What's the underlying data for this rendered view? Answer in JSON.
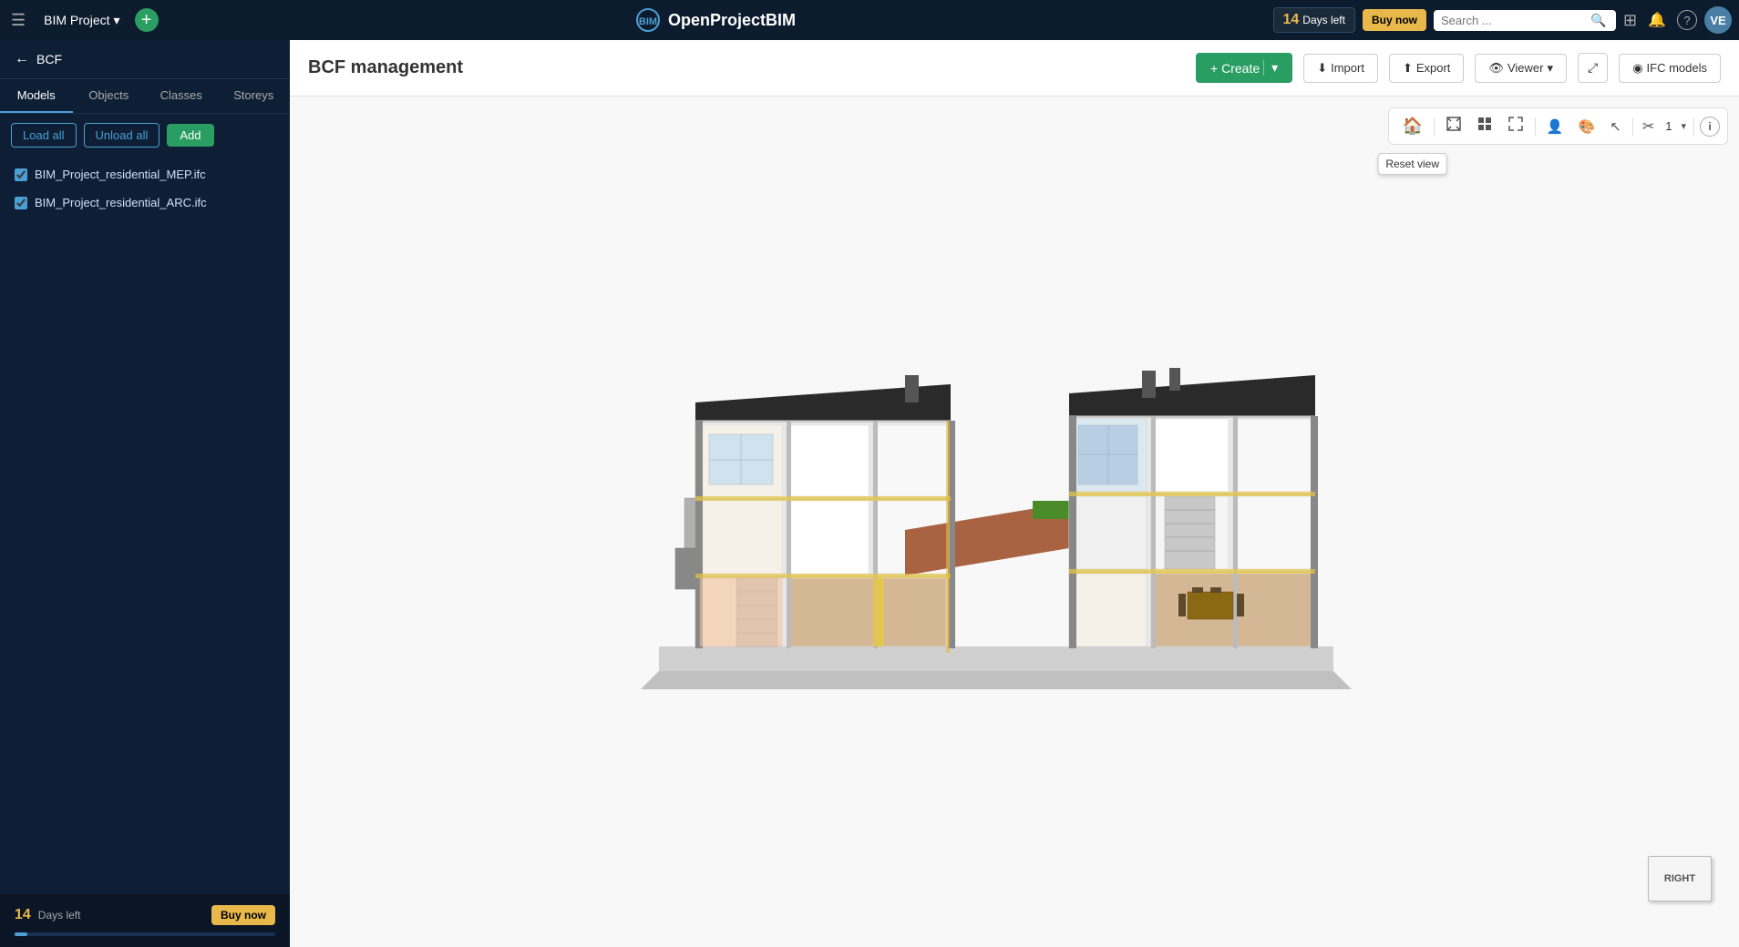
{
  "topnav": {
    "menu_icon": "☰",
    "project_name": "BIM Project",
    "project_caret": "▾",
    "add_icon": "+",
    "logo_text": "OpenProjectBIM",
    "trial_days": "14",
    "trial_days_label": "Days left",
    "buy_now_label": "Buy now",
    "search_placeholder": "Search ...",
    "grid_icon": "⊞",
    "bell_icon": "🔔",
    "help_icon": "?",
    "avatar_initials": "VE"
  },
  "sidebar": {
    "back_label": "BCF",
    "tabs": [
      "Models",
      "Objects",
      "Classes",
      "Storeys"
    ],
    "active_tab": "Models",
    "load_all_label": "Load all",
    "unload_all_label": "Unload all",
    "add_label": "Add",
    "models": [
      {
        "name": "BIM_Project_residential_MEP.ifc",
        "checked": true
      },
      {
        "name": "BIM_Project_residential_ARC.ifc",
        "checked": true
      }
    ],
    "trial_days": "14",
    "trial_days_label": "Days left",
    "buy_now_label": "Buy now",
    "progress_pct": 5
  },
  "main": {
    "page_title": "BCF management",
    "create_label": "Create",
    "import_label": "Import",
    "export_label": "Export",
    "viewer_label": "Viewer",
    "ifc_models_label": "IFC models",
    "toolbar": {
      "reset_view_tooltip": "Reset view",
      "section_box_icon": "⧈",
      "grid_view_icon": "⊞",
      "expand_icon": "⤢",
      "person_icon": "👤",
      "paint_icon": "🖌",
      "select_icon": "↖",
      "scissors_icon": "✂",
      "count_value": "1",
      "info_icon": "ⓘ"
    },
    "cube_face_label": "RIGHT"
  }
}
